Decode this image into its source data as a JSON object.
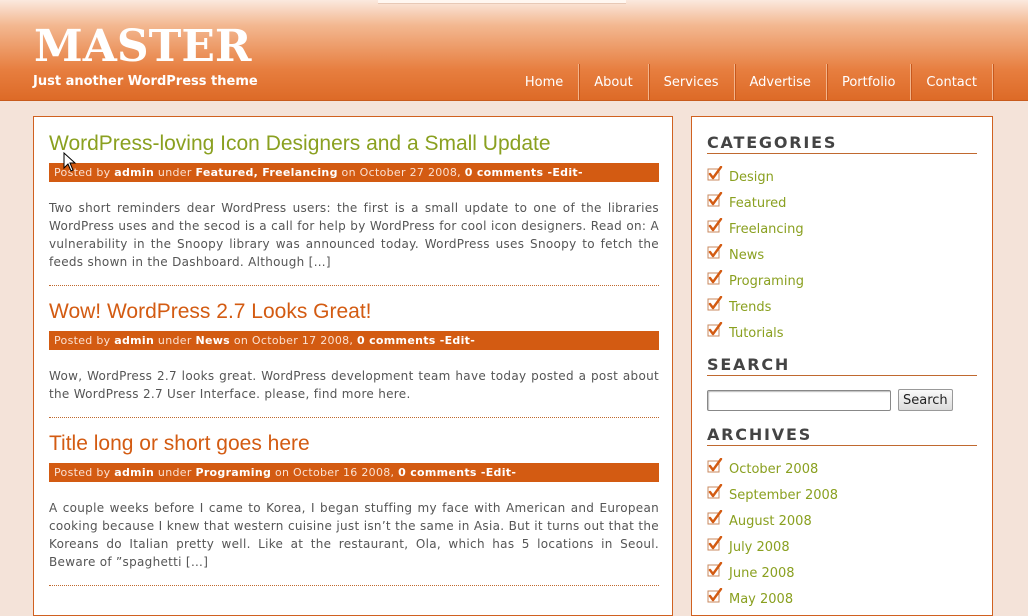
{
  "header": {
    "site_title": "MASTER",
    "tagline": "Just another WordPress theme",
    "nav": [
      "Home",
      "About",
      "Services",
      "Advertise",
      "Portfolio",
      "Contact"
    ]
  },
  "colors": {
    "accent": "#d35b12",
    "link_green": "#8aa020",
    "page_bg": "#f4e3d9"
  },
  "posts": [
    {
      "title": "WordPress-loving Icon Designers and a Small Update",
      "title_color": "#8aa020",
      "meta_prefix": "Posted by ",
      "author": "admin",
      "under": " under ",
      "categories": "Featured, Freelancing",
      "date_text": " on October 27 2008, ",
      "comments": "0 comments",
      "edit": " -Edit-",
      "excerpt": "Two short reminders dear WordPress users: the first is a small update to one of the libraries WordPress uses and the secod is a call for help by WordPress for cool icon designers. Read on: A vulnerability in the Snoopy library was announced today.  WordPress uses Snoopy to fetch the feeds shown in the Dashboard.   Although […]"
    },
    {
      "title": "Wow! WordPress 2.7 Looks Great!",
      "title_color": "#d35b12",
      "meta_prefix": "Posted by ",
      "author": "admin",
      "under": " under ",
      "categories": "News",
      "date_text": " on October 17 2008, ",
      "comments": "0 comments",
      "edit": " -Edit-",
      "excerpt": "Wow, WordPress 2.7 looks great. WordPress development team have today posted a post about the WordPress 2.7 User Interface. please, find more here."
    },
    {
      "title": "Title long or short goes here",
      "title_color": "#d35b12",
      "meta_prefix": "Posted by ",
      "author": "admin",
      "under": " under ",
      "categories": "Programing",
      "date_text": " on October 16 2008, ",
      "comments": "0 comments",
      "edit": " -Edit-",
      "excerpt": "A couple weeks before I came to Korea, I began stuffing my face with American and European cooking because I knew that western cuisine just isn’t the same in Asia. But it turns out that the Koreans do Italian pretty well. Like at the restaurant, Ola, which has 5 locations in Seoul. Beware of ”spaghetti […]"
    }
  ],
  "sidebar": {
    "categories_title": "CATEGORIES",
    "categories": [
      "Design",
      "Featured",
      "Freelancing",
      "News",
      "Programing",
      "Trends",
      "Tutorials"
    ],
    "search_title": "SEARCH",
    "search_value": "",
    "search_button": "Search",
    "archives_title": "ARCHIVES",
    "archives": [
      "October 2008",
      "September 2008",
      "August 2008",
      "July 2008",
      "June 2008",
      "May 2008"
    ]
  },
  "icons": {
    "list_bullet": "checkbox-check-icon",
    "cursor": "mouse-pointer-icon"
  }
}
